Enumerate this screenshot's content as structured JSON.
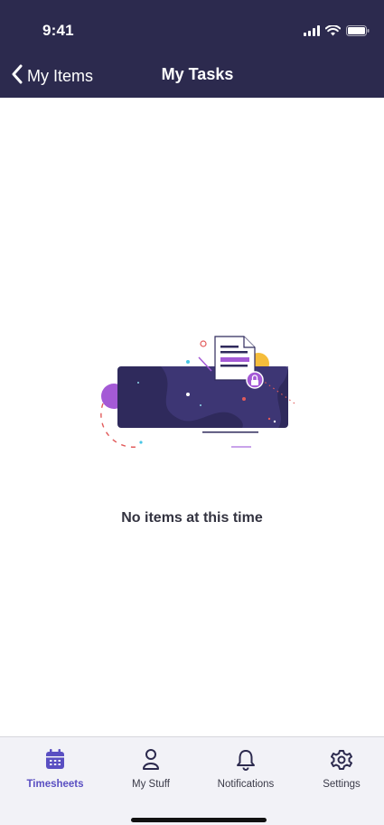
{
  "status_bar": {
    "time": "9:41",
    "icons": [
      "signal-icon",
      "wifi-icon",
      "battery-icon"
    ]
  },
  "nav": {
    "back_label": "My Items",
    "title": "My Tasks",
    "back_icon": "chevron-left-icon"
  },
  "main": {
    "empty_message": "No items at this time",
    "illustration": "empty-tasks-illustration"
  },
  "tab_bar": {
    "active": "Timesheets",
    "tabs": [
      {
        "label": "Timesheets",
        "icon": "calendar-icon"
      },
      {
        "label": "My Stuff",
        "icon": "person-icon"
      },
      {
        "label": "Notifications",
        "icon": "bell-icon"
      },
      {
        "label": "Settings",
        "icon": "gear-icon"
      }
    ]
  },
  "colors": {
    "header_bg": "#2c2a4e",
    "accent": "#5a4fc2",
    "tab_bar_bg": "#f2f2f7",
    "text_dark": "#333340"
  }
}
